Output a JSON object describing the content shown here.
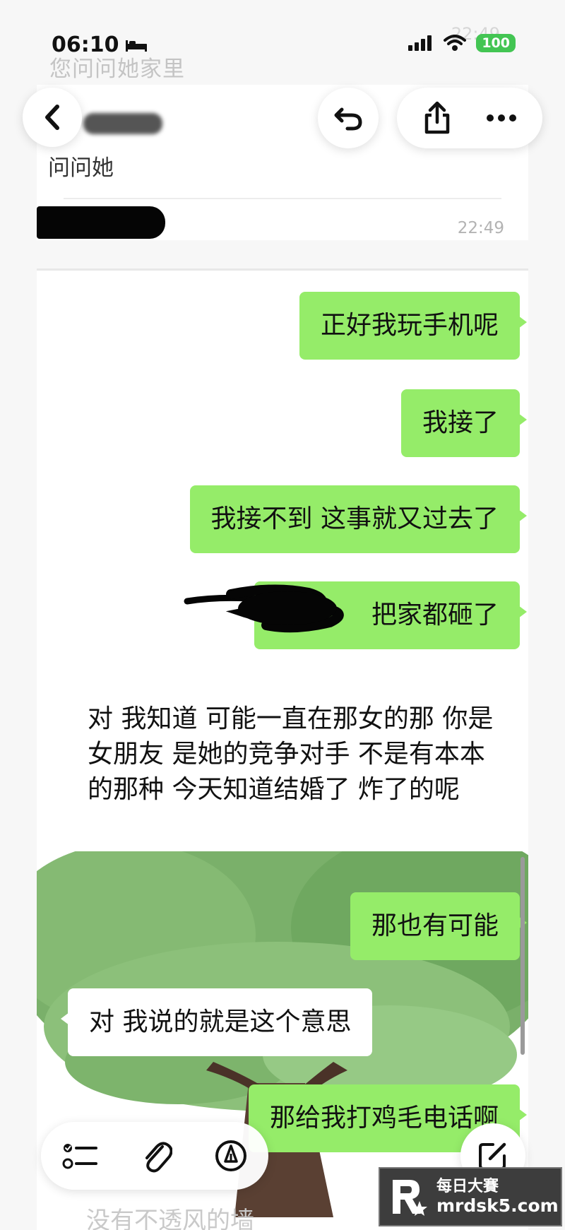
{
  "status_bar": {
    "time": "06:10",
    "battery": "100"
  },
  "background": {
    "top_faded_text": "您问问她家里",
    "top_faded_time": "22:49",
    "bottom_faded_text": "没有不透风的墙"
  },
  "earlier_message": {
    "text": "问问她",
    "time": "22:49"
  },
  "messages": [
    {
      "side": "out",
      "text": "正好我玩手机呢"
    },
    {
      "side": "out",
      "text": "我接了"
    },
    {
      "side": "out",
      "text": "我接不到 这事就又过去了"
    },
    {
      "side": "out",
      "text": "把家都砸了"
    },
    {
      "side": "in",
      "text": "对 我知道 可能一直在那女的那 你是女朋友 是她的竞争对手 不是有本本的那种 今天知道结婚了 炸了的呢"
    },
    {
      "side": "out",
      "text": "那也有可能"
    },
    {
      "side": "in",
      "text": "对 我说的就是这个意思"
    },
    {
      "side": "out",
      "text": "那给我打鸡毛电话啊"
    }
  ],
  "watermark": {
    "line1": "每日大賽",
    "line2": "mrdsk5.com"
  },
  "icons": {
    "back": "chevron-left-icon",
    "undo": "undo-arrow-icon",
    "share": "share-icon",
    "more": "more-dots-icon",
    "checklist": "checklist-icon",
    "attach": "paperclip-icon",
    "markup": "pen-markup-icon",
    "compose": "compose-icon"
  },
  "colors": {
    "outgoing_bubble": "#95ec69",
    "incoming_bubble": "#ffffff",
    "battery": "#43c553"
  }
}
